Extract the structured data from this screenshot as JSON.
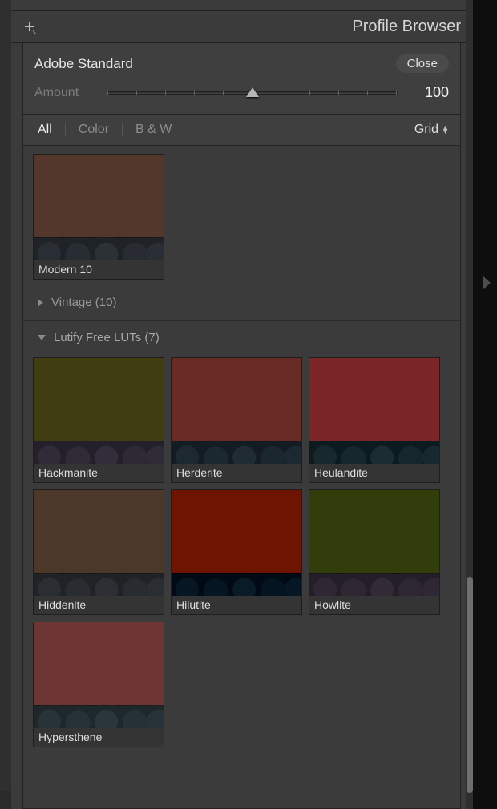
{
  "panel": {
    "title": "Profile Browser",
    "profile_name": "Adobe Standard",
    "close_label": "Close",
    "amount_label": "Amount",
    "amount_value": "100"
  },
  "filters": {
    "all": "All",
    "color": "Color",
    "bw": "B & W",
    "view_label": "Grid"
  },
  "stray": {
    "name": "Modern 10"
  },
  "groups": {
    "vintage": {
      "label": "Vintage (10)"
    },
    "lutify": {
      "label": "Lutify Free LUTs (7)"
    }
  },
  "luts": [
    {
      "name": "Hackmanite",
      "tint": "tint-purple"
    },
    {
      "name": "Herderite",
      "tint": "tint-red"
    },
    {
      "name": "Heulandite",
      "tint": "tint-orange"
    },
    {
      "name": "Hiddenite",
      "tint": "tint-cool"
    },
    {
      "name": "Hilutite",
      "tint": "tint-deepred"
    },
    {
      "name": "Howlite",
      "tint": "tint-mag"
    },
    {
      "name": "Hypersthene",
      "tint": "tint-amber"
    }
  ]
}
